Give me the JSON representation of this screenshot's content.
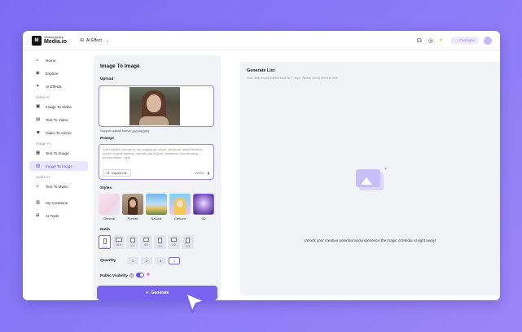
{
  "brand": {
    "line1": "Wondershare",
    "line2": "Media.io",
    "mark": "M"
  },
  "header": {
    "product_switch": "AI Effect",
    "purchase_label": "Purchase"
  },
  "sidebar": {
    "items_top": [
      {
        "label": "Home",
        "icon": "home-icon",
        "glyph": "⌂"
      },
      {
        "label": "Explore",
        "icon": "compass-icon",
        "glyph": "◉"
      },
      {
        "label": "AI Effects",
        "icon": "sparkle-icon",
        "glyph": "✦"
      }
    ],
    "groups": [
      {
        "title": "Video AI",
        "items": [
          {
            "label": "Image To Video",
            "icon": "image-video-icon",
            "glyph": "▣"
          },
          {
            "label": "Text To Video",
            "icon": "text-video-icon",
            "glyph": "▤"
          },
          {
            "label": "Video To Anime",
            "icon": "anime-icon",
            "glyph": "☻"
          }
        ]
      },
      {
        "title": "Image AI",
        "items": [
          {
            "label": "Text To Image",
            "icon": "text-image-icon",
            "glyph": "▦"
          },
          {
            "label": "Image To Image",
            "icon": "image-image-icon",
            "glyph": "▧",
            "active": true
          }
        ]
      },
      {
        "title": "Audio AI",
        "items": [
          {
            "label": "Text To Music",
            "icon": "music-icon",
            "glyph": "♫"
          }
        ]
      }
    ],
    "items_bottom": [
      {
        "label": "My Creations",
        "icon": "creations-icon",
        "glyph": "▥"
      },
      {
        "label": "AI Tools",
        "icon": "tools-icon",
        "glyph": "⊞"
      }
    ]
  },
  "panel": {
    "title": "Image To Image",
    "upload_label": "Upload",
    "support_note": "Support upload format: jpg,png,jpeg",
    "prompt_label": "Prompt",
    "prompt_text": "Add realistic change to the original girl photo, preserve facial features, match original lighting, natural hair texture, seamless hair blending, photorealistic, style",
    "inspire_label": "Inspire me",
    "counter": "0/2000",
    "styles_label": "Styles",
    "styles": [
      "General",
      "Portrait",
      "Natural",
      "Cartoon",
      "3D"
    ],
    "ratio_label": "Ratio",
    "ratios": [
      "9:16",
      "16:9",
      "1:1",
      "4:3",
      "3:4",
      "3:2",
      "2:3"
    ],
    "quantity_label": "Quantity",
    "quantities": [
      "1",
      "2",
      "3",
      "4"
    ],
    "visibility_label": "Public Visibility",
    "generate_label": "Generate"
  },
  "generate_list": {
    "title": "Generate List",
    "subtitle": "Your task results will be kept for 7 days. Please check them in time.",
    "empty_text": "Unlock your creative potential and experience the magic of Media AI right away!"
  },
  "colors": {
    "accent": "#7a63f1",
    "background": "#8a78f6",
    "panel": "#f1f3f7"
  }
}
